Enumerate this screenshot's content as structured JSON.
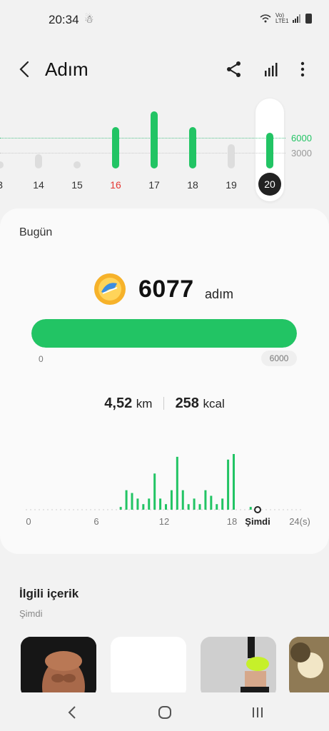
{
  "status": {
    "time": "20:34",
    "network": "Vo) LTE1"
  },
  "appbar": {
    "title": "Adım"
  },
  "week": {
    "goal_label": "6000",
    "base_label": "3000",
    "days": [
      {
        "label": "3",
        "color": "#dddddd",
        "level": 0.05,
        "weekend": false
      },
      {
        "label": "14",
        "color": "#dddddd",
        "level": 0.25,
        "weekend": false
      },
      {
        "label": "15",
        "color": "#dddddd",
        "level": 0.05,
        "weekend": false
      },
      {
        "label": "16",
        "color": "#22c464",
        "level": 0.72,
        "weekend": true
      },
      {
        "label": "17",
        "color": "#22c464",
        "level": 1.0,
        "weekend": false
      },
      {
        "label": "18",
        "color": "#22c464",
        "level": 0.72,
        "weekend": false
      },
      {
        "label": "19",
        "color": "#dddddd",
        "level": 0.42,
        "weekend": false
      },
      {
        "label": "20",
        "color": "#22c464",
        "level": 0.62,
        "weekend": false
      }
    ]
  },
  "today": {
    "title": "Bugün",
    "steps": "6077",
    "steps_unit": "adım",
    "progress_min": "0",
    "progress_max": "6000",
    "progress_fraction": 1.0,
    "distance": "4,52",
    "distance_unit": "km",
    "calories": "258",
    "calories_unit": "kcal"
  },
  "hourly": {
    "axis_labels": [
      "0",
      "6",
      "12",
      "18",
      "24(s)"
    ],
    "now_label": "Şimdi",
    "values": [
      0,
      0,
      0,
      0,
      0,
      0,
      0,
      0,
      0,
      0,
      0,
      0,
      0,
      0,
      0,
      0,
      0.05,
      0.35,
      0.3,
      0.2,
      0.1,
      0.2,
      0.65,
      0.2,
      0.1,
      0.35,
      0.95,
      0.35,
      0.1,
      0.2,
      0.1,
      0.35,
      0.25,
      0.1,
      0.2,
      0.9,
      1.0,
      0,
      0,
      0.05,
      0.05,
      0,
      0,
      0,
      0,
      0,
      0,
      0
    ]
  },
  "related": {
    "title": "İlgili içerik",
    "subtitle": "Şimdi"
  },
  "colors": {
    "accent": "#22c464",
    "weekend": "#e53935"
  }
}
